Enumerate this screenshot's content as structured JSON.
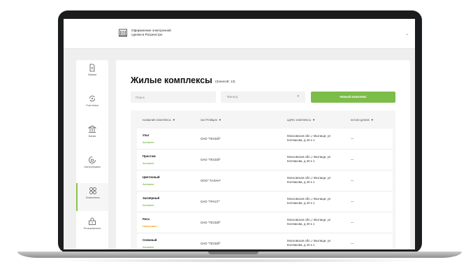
{
  "header": {
    "brand_line1": "Оформление электронной",
    "brand_line2": "сделки в Росреестре"
  },
  "sidebar": {
    "items": [
      {
        "label": "Заявки",
        "icon": "document-icon"
      },
      {
        "label": "Участники",
        "icon": "participants-icon"
      },
      {
        "label": "Банки",
        "icon": "bank-icon"
      },
      {
        "label": "Застройщики",
        "icon": "developer-icon"
      },
      {
        "label": "Комплексы",
        "icon": "grid-icon",
        "active": true
      },
      {
        "label": "Пользователи",
        "icon": "users-icon"
      }
    ]
  },
  "main": {
    "title": "Жилые комплексы",
    "records": "(Записей: 13)",
    "search_placeholder": "Поиск",
    "filter_label": "Фильтр",
    "new_button": "Новый комплекс"
  },
  "table": {
    "headers": [
      "НАЗВАНИЕ КОМПЛЕКСА",
      "ЗАСТРОЙЩИК",
      "АДРЕС КОМПЛЕКСА",
      "КОЛ-ВО ДОМОВ"
    ],
    "rows": [
      {
        "name": "Ульт",
        "status": "Активен",
        "developer": "ОАО \"ТЕСЕЙ\"",
        "addr1": "Московская обл.,г Мытищи, ул",
        "addr2": "Колпакова, д 40 к 1",
        "houses": "—"
      },
      {
        "name": "Престиж",
        "status": "Активен",
        "developer": "ОАО \"ТЕСЕЙ\"",
        "addr1": "Московская обл.,г Мытищи, ул",
        "addr2": "Колпакова, д 40 к 1",
        "houses": "—"
      },
      {
        "name": "Цветочный",
        "status": "Активен",
        "developer": "ООО \"ТАЛАН\"",
        "addr1": "Московская обл.,г Мытищи, ул",
        "addr2": "Колпакова, д 40 к 1",
        "houses": "—"
      },
      {
        "name": "Заозёрный",
        "status": "Активен",
        "developer": "ОАО \"ТРАСТ\"",
        "addr1": "Московская обл.,г Мытищи, ул",
        "addr2": "Колпакова, д 40 к 1",
        "houses": "—"
      },
      {
        "name": "Рига",
        "status": "Неактивен",
        "developer": "ОАО \"ТЕСЕЙ\"",
        "addr1": "Московская обл.,г Мытищи, ул",
        "addr2": "Колпакова, д 40 к 1",
        "houses": "—"
      },
      {
        "name": "Снежный",
        "status": "Активен",
        "developer": "ОАО \"ТЕСЕЙ\"",
        "addr1": "Московская обл.,г Мытищи, ул",
        "addr2": "Колпакова, д 40 к 1",
        "houses": "—"
      }
    ]
  },
  "colors": {
    "accent": "#7cbc48",
    "status_active": "#7cbc48",
    "status_inactive": "#f0a020"
  }
}
